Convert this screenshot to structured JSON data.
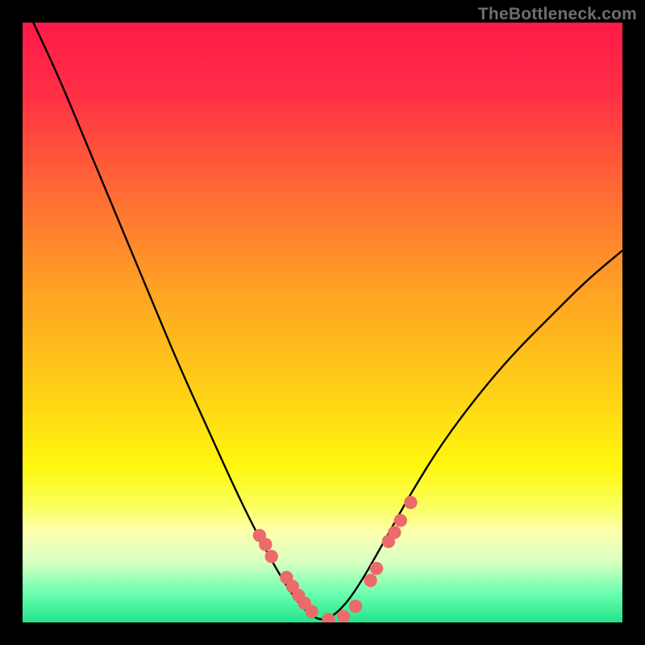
{
  "watermark": "TheBottleneck.com",
  "chart_data": {
    "type": "line",
    "title": "",
    "xlabel": "",
    "ylabel": "",
    "xlim": [
      0,
      1
    ],
    "ylim": [
      0,
      1
    ],
    "gradient_stops": [
      {
        "offset": 0.0,
        "color": "#ff1a49"
      },
      {
        "offset": 0.12,
        "color": "#ff2f45"
      },
      {
        "offset": 0.28,
        "color": "#ff6a34"
      },
      {
        "offset": 0.45,
        "color": "#ffa324"
      },
      {
        "offset": 0.62,
        "color": "#ffd216"
      },
      {
        "offset": 0.74,
        "color": "#fff70e"
      },
      {
        "offset": 0.8,
        "color": "#fbff54"
      },
      {
        "offset": 0.85,
        "color": "#fdffb0"
      },
      {
        "offset": 0.9,
        "color": "#d6ffc0"
      },
      {
        "offset": 0.95,
        "color": "#6dffb0"
      },
      {
        "offset": 1.0,
        "color": "#21e58a"
      }
    ],
    "series": [
      {
        "name": "bottleneck-curve",
        "color": "#000000",
        "x": [
          0.018,
          0.06,
          0.11,
          0.16,
          0.21,
          0.26,
          0.31,
          0.36,
          0.4,
          0.44,
          0.47,
          0.5,
          0.53,
          0.56,
          0.6,
          0.65,
          0.7,
          0.76,
          0.82,
          0.88,
          0.94,
          1.0
        ],
        "y": [
          1.0,
          0.91,
          0.79,
          0.67,
          0.55,
          0.43,
          0.32,
          0.21,
          0.13,
          0.06,
          0.02,
          0.0,
          0.02,
          0.06,
          0.13,
          0.22,
          0.3,
          0.38,
          0.45,
          0.51,
          0.57,
          0.62
        ]
      }
    ],
    "marker_groups": [
      {
        "name": "near-min-markers",
        "color": "#ec6a6a",
        "radius_data": 0.011,
        "points": [
          {
            "x": 0.395,
            "y": 0.145
          },
          {
            "x": 0.405,
            "y": 0.13
          },
          {
            "x": 0.415,
            "y": 0.11
          },
          {
            "x": 0.44,
            "y": 0.075
          },
          {
            "x": 0.45,
            "y": 0.06
          },
          {
            "x": 0.46,
            "y": 0.045
          },
          {
            "x": 0.47,
            "y": 0.032
          },
          {
            "x": 0.482,
            "y": 0.018
          },
          {
            "x": 0.51,
            "y": 0.005
          },
          {
            "x": 0.535,
            "y": 0.01
          },
          {
            "x": 0.555,
            "y": 0.027
          },
          {
            "x": 0.58,
            "y": 0.07
          },
          {
            "x": 0.59,
            "y": 0.09
          },
          {
            "x": 0.61,
            "y": 0.135
          },
          {
            "x": 0.62,
            "y": 0.15
          },
          {
            "x": 0.63,
            "y": 0.17
          },
          {
            "x": 0.647,
            "y": 0.2
          }
        ]
      }
    ]
  }
}
